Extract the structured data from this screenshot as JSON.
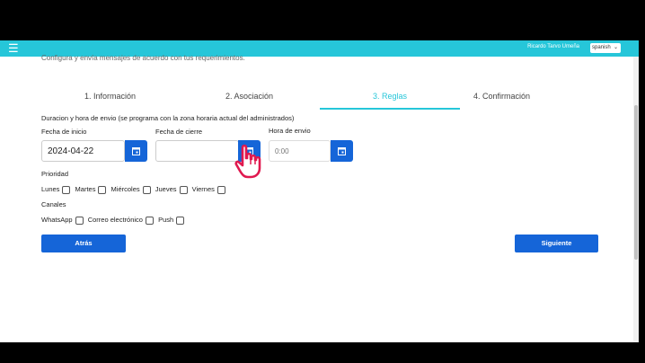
{
  "header": {
    "user_name": "Ricardo Tarvo Umeña",
    "language": "spanish"
  },
  "page": {
    "subtitle": "Configura y envía mensajes de acuerdo con tus requerimientos."
  },
  "tabs": [
    {
      "label": "1. Información"
    },
    {
      "label": "2. Asociación"
    },
    {
      "label": "3. Reglas"
    },
    {
      "label": "4. Confirmación"
    }
  ],
  "form": {
    "section_title": "Duracion y hora de envio (se programa con la zona horaria actual del administrados)",
    "start_date": {
      "label": "Fecha de inicio",
      "value": "2024-04-22"
    },
    "close_date": {
      "label": "Fecha de cierre",
      "value": ""
    },
    "send_time": {
      "label": "Hora de envio",
      "placeholder": "0:00"
    },
    "priority": {
      "label": "Prioridad",
      "days": [
        "Lunes",
        "Martes",
        "Miércoles",
        "Jueves",
        "Viernes"
      ]
    },
    "channels": {
      "label": "Canales",
      "options": [
        "WhatsApp",
        "Correo electrónico",
        "Push"
      ]
    }
  },
  "buttons": {
    "back": "Atrás",
    "next": "Siguiente"
  },
  "colors": {
    "accent": "#26c6d9",
    "primary": "#1565d8"
  }
}
